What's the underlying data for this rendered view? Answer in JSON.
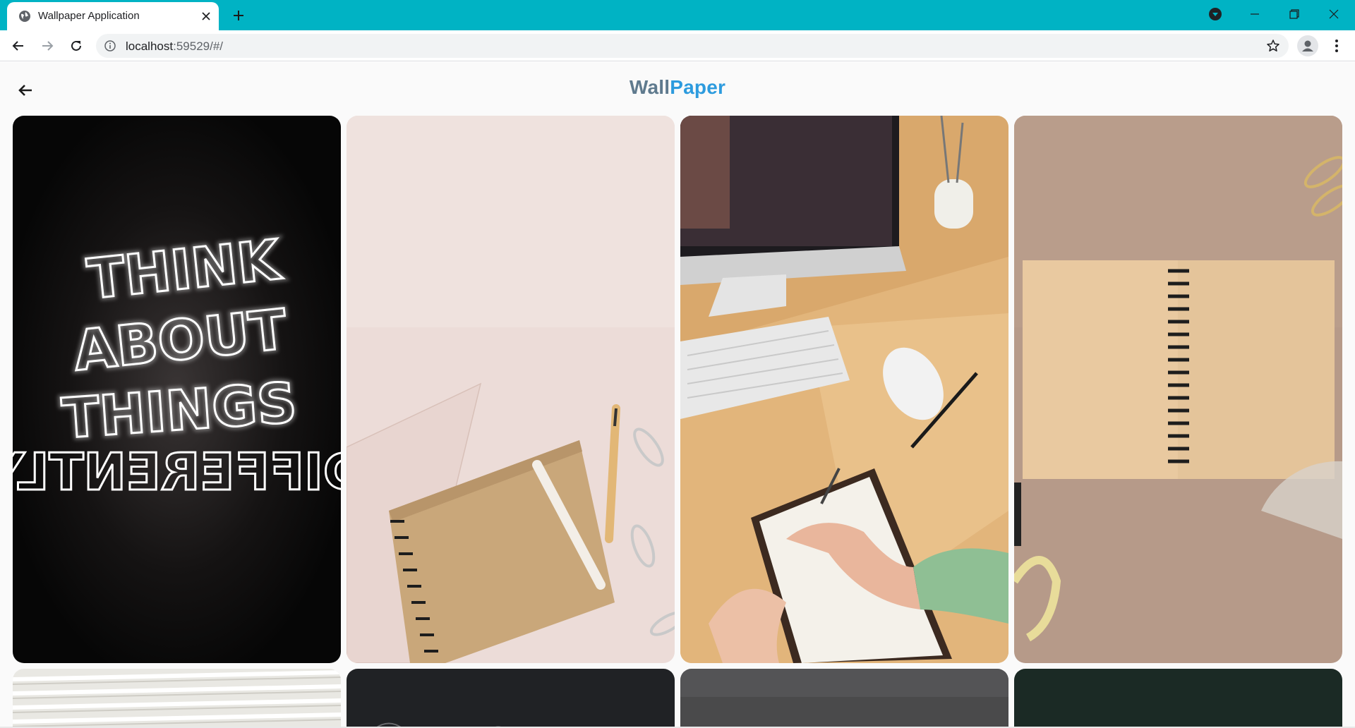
{
  "browser": {
    "tab_title": "Wallpaper Application",
    "url_host": "localhost",
    "url_rest": ":59529/#/",
    "icons": {
      "favicon": "globe-icon",
      "tab_close": "close-icon",
      "new_tab": "plus-icon",
      "back": "arrow-left-icon",
      "forward": "arrow-right-icon",
      "reload": "reload-icon",
      "site_info": "info-icon",
      "bookmark": "star-icon",
      "profile": "person-icon",
      "menu": "kebab-icon",
      "media": "media-control-icon",
      "minimize": "minimize-icon",
      "restore": "restore-icon",
      "close_window": "close-window-icon"
    },
    "colors": {
      "titlebar": "#00b3c4"
    }
  },
  "app": {
    "brand_part1": "Wall",
    "brand_part2": "Paper",
    "colors": {
      "brand_part1": "#5f7a8e",
      "brand_part2": "#2d9bde",
      "background": "#fafafa"
    },
    "wallpapers": [
      {
        "subject": "neon sign",
        "neon_text": [
          "THINK",
          "ABOUT",
          "THINGS",
          "DIFFERENTLY"
        ]
      },
      {
        "subject": "notebook and pencils on pink desk"
      },
      {
        "subject": "desk with computer, keyboard and writing hand"
      },
      {
        "subject": "open spiral notebook on brown desk"
      },
      {
        "subject": "white stacked paper"
      },
      {
        "subject": "dark chalkboard"
      },
      {
        "subject": "grey chalkboard"
      },
      {
        "subject": "green chalkboard"
      }
    ]
  }
}
